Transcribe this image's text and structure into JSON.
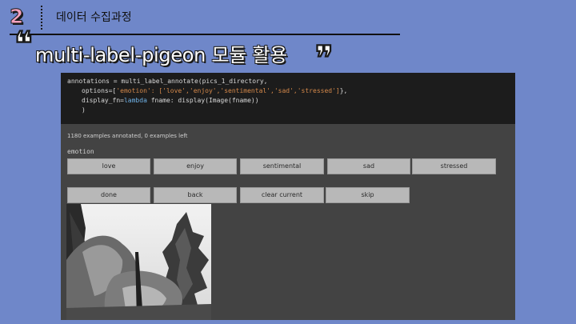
{
  "header": {
    "number": "2",
    "section": "데이터 수집과정",
    "title": "multi-label-pigeon 모듈 활용",
    "open_quote": "❝",
    "close_quote": "❞"
  },
  "code": {
    "line1": "annotations = multi_label_annotate(pics_1_directory,",
    "line2_prefix": "options=[",
    "line2_strings": "'emotion': ['love','enjoy','sentimental','sad','stressed']",
    "line2_suffix": "},",
    "line3_prefix": "display_fn=",
    "line3_kw": "lambda",
    "line3_suffix": " fname: display(Image(fname))",
    "line4": ")"
  },
  "status": "1180 examples annotated, 0 examples left",
  "label_name": "emotion",
  "emotion_buttons": [
    "love",
    "enjoy",
    "sentimental",
    "sad",
    "stressed"
  ],
  "control_buttons": [
    "done",
    "back",
    "clear current",
    "skip"
  ],
  "photo": {
    "description_icon": "tree-photo"
  }
}
